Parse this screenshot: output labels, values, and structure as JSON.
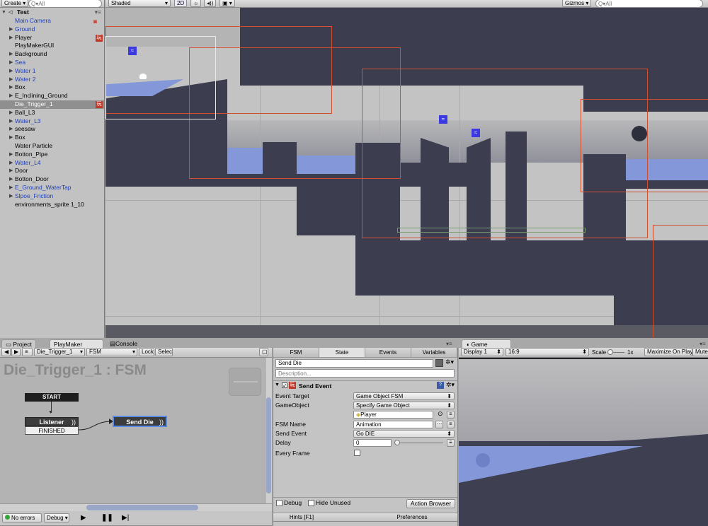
{
  "hierarchy": {
    "create_label": "Create",
    "search_placeholder": "Q▾All",
    "root": "Test",
    "items": [
      {
        "label": "Main Camera",
        "blue": true,
        "arrow": false
      },
      {
        "label": "Ground",
        "blue": true,
        "arrow": true
      },
      {
        "label": "Player",
        "blue": false,
        "arrow": true,
        "badge": "玩"
      },
      {
        "label": "PlayMakerGUI",
        "blue": false,
        "arrow": false
      },
      {
        "label": "Background",
        "blue": false,
        "arrow": true
      },
      {
        "label": "Sea",
        "blue": true,
        "arrow": true
      },
      {
        "label": "Water 1",
        "blue": true,
        "arrow": true
      },
      {
        "label": "Water 2",
        "blue": true,
        "arrow": true
      },
      {
        "label": "Box",
        "blue": false,
        "arrow": true
      },
      {
        "label": "E_Inclining_Ground",
        "blue": false,
        "arrow": true
      },
      {
        "label": "Die_Trigger_1",
        "blue": false,
        "arrow": false,
        "selected": true,
        "badge": "玩"
      },
      {
        "label": "Ball_L3",
        "blue": false,
        "arrow": true
      },
      {
        "label": "Water_L3",
        "blue": true,
        "arrow": true
      },
      {
        "label": "seesaw",
        "blue": false,
        "arrow": true
      },
      {
        "label": "Box",
        "blue": false,
        "arrow": true
      },
      {
        "label": "Water Particle",
        "blue": false,
        "arrow": false
      },
      {
        "label": "Botton_Pipe",
        "blue": false,
        "arrow": true
      },
      {
        "label": "Water_L4",
        "blue": true,
        "arrow": true
      },
      {
        "label": "Door",
        "blue": false,
        "arrow": true
      },
      {
        "label": "Botton_Door",
        "blue": false,
        "arrow": true
      },
      {
        "label": "E_Ground_WaterTap",
        "blue": true,
        "arrow": true
      },
      {
        "label": "Slpoe_Friction",
        "blue": true,
        "arrow": true
      },
      {
        "label": "environments_sprite 1_10",
        "blue": false,
        "arrow": false
      }
    ]
  },
  "scene": {
    "shading_mode": "Shaded",
    "mode_2d": "2D",
    "gizmos_label": "Gizmos",
    "search_placeholder": "Q▾All"
  },
  "bottom_tabs": {
    "project": "Project",
    "playmaker": "PlayMaker",
    "console": "Console",
    "game": "Game"
  },
  "playmaker": {
    "object_dropdown": "Die_Trigger_1",
    "fsm_dropdown": "FSM",
    "lock_label": "Lock",
    "select_label": "Select",
    "graph_title": "Die_Trigger_1 : FSM",
    "start_node": "START",
    "listener_state": "Listener",
    "listener_event": "FINISHED",
    "send_die_state": "Send Die",
    "status_no_errors": "No errors",
    "debug_dropdown": "Debug"
  },
  "inspector": {
    "tabs": [
      "FSM",
      "State",
      "Events",
      "Variables"
    ],
    "active_tab": "State",
    "state_name": "Send Die",
    "description_placeholder": "Description...",
    "action_name": "Send Event",
    "props": {
      "event_target_label": "Event Target",
      "event_target_value": "Game Object FSM",
      "gameobject_label": "GameObject",
      "gameobject_mode": "Specify Game Object",
      "gameobject_value": "Player",
      "fsm_name_label": "FSM Name",
      "fsm_name_value": "Animation",
      "send_event_label": "Send Event",
      "send_event_value": "Go DIE",
      "delay_label": "Delay",
      "delay_value": "0",
      "every_frame_label": "Every Frame"
    },
    "debug_label": "Debug",
    "hide_unused_label": "Hide Unused",
    "action_browser": "Action Browser",
    "hints": "Hints [F1]",
    "preferences": "Preferences"
  },
  "game": {
    "display": "Display 1",
    "aspect": "16:9",
    "scale_label": "Scale",
    "scale_value": "1x",
    "maximize": "Maximize On Play",
    "mute": "Mute"
  }
}
